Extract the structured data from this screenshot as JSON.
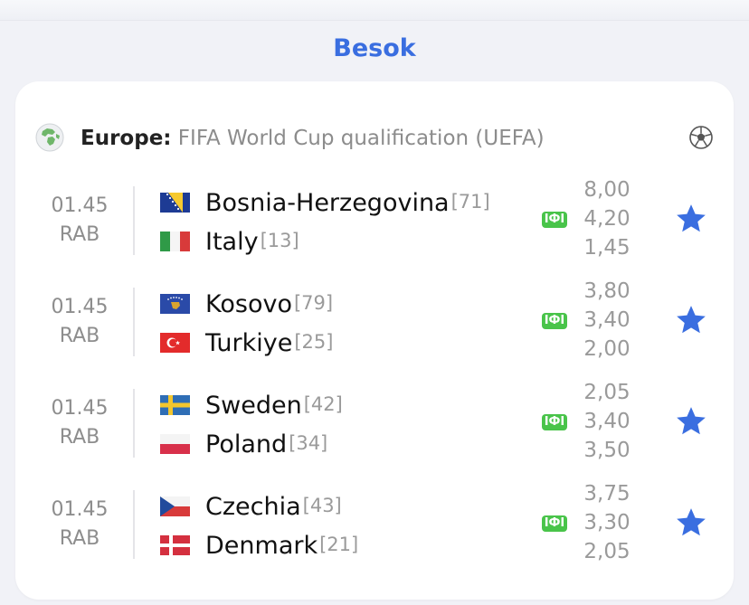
{
  "header": {
    "day_title": "Besok"
  },
  "league": {
    "region": "Europe",
    "separator": ":",
    "competition": " FIFA World Cup qualification (UEFA)",
    "globe_icon": "globe-europe-icon",
    "sport_icon": "soccer-ball-icon"
  },
  "colors": {
    "accent": "#3a6ee0",
    "star": "#3a6ee0",
    "tv_badge": "#49c44a"
  },
  "matches": [
    {
      "time": "01.45",
      "day": "RAB",
      "home": {
        "name": "Bosnia-Herzegovina",
        "rank": "[71]",
        "flag": "bosnia-flag"
      },
      "away": {
        "name": "Italy",
        "rank": "[13]",
        "flag": "italy-flag"
      },
      "tv_label": "IФI",
      "odds": [
        "8,00",
        "4,20",
        "1,45"
      ]
    },
    {
      "time": "01.45",
      "day": "RAB",
      "home": {
        "name": "Kosovo",
        "rank": "[79]",
        "flag": "kosovo-flag"
      },
      "away": {
        "name": "Turkiye",
        "rank": "[25]",
        "flag": "turkey-flag"
      },
      "tv_label": "IФI",
      "odds": [
        "3,80",
        "3,40",
        "2,00"
      ]
    },
    {
      "time": "01.45",
      "day": "RAB",
      "home": {
        "name": "Sweden",
        "rank": "[42]",
        "flag": "sweden-flag"
      },
      "away": {
        "name": "Poland",
        "rank": "[34]",
        "flag": "poland-flag"
      },
      "tv_label": "IФI",
      "odds": [
        "2,05",
        "3,40",
        "3,50"
      ]
    },
    {
      "time": "01.45",
      "day": "RAB",
      "home": {
        "name": "Czechia",
        "rank": "[43]",
        "flag": "czechia-flag"
      },
      "away": {
        "name": "Denmark",
        "rank": "[21]",
        "flag": "denmark-flag"
      },
      "tv_label": "IФI",
      "odds": [
        "3,75",
        "3,30",
        "2,05"
      ]
    }
  ]
}
